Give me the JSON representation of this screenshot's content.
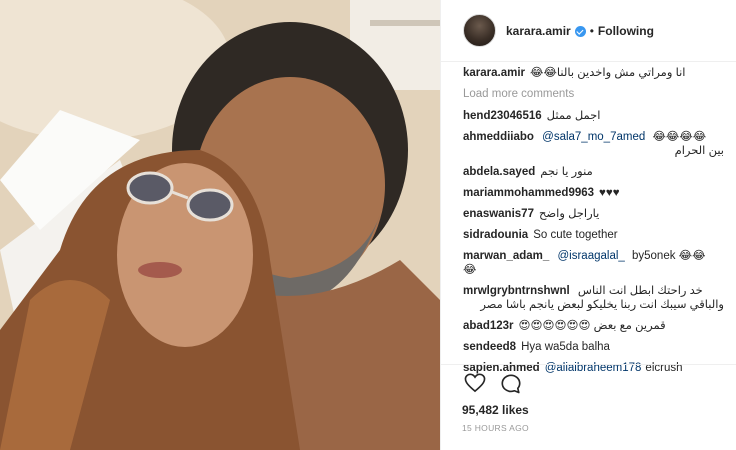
{
  "header": {
    "username": "karara.amir",
    "following_label": "Following",
    "dot": "•"
  },
  "caption": {
    "username": "karara.amir",
    "text": "انا ومراتي مش واخدين بالنا😂😂"
  },
  "load_more_label": "Load more comments",
  "comments": [
    {
      "username": "hend23046516",
      "text": "اجمل ممثل"
    },
    {
      "username": "ahmeddiiabo",
      "mention": "@sala7_mo_7amed",
      "text": "😂😂😂😂",
      "text2": "بين الحرام"
    },
    {
      "username": "abdela.sayed",
      "text": "منور يا نجم"
    },
    {
      "username": "mariammohammed9963",
      "text": "♥♥♥"
    },
    {
      "username": "enaswanis77",
      "text": "ياراجل واضح"
    },
    {
      "username": "sidradounia",
      "text": "So cute together"
    },
    {
      "username": "marwan_adam_",
      "mention": "@israagalal_",
      "text": "by5onek 😂😂",
      "text2": "😂"
    },
    {
      "username": "mrwlgrybntrnshwnl",
      "text": "خد راحتك ابطل انت الناس",
      "text2": "والباقي سيبك انت ربنا يخليكو لبعض يانجم باشا مصر"
    },
    {
      "username": "abad123r",
      "text": "قمرين مع بعض 😍😍😍😍😍😍"
    },
    {
      "username": "sendeed8",
      "text": "Hya wa5da balha"
    },
    {
      "username": "sapien.ahmed",
      "mention": "@aliaibraheem178",
      "text": "elcrush"
    }
  ],
  "actions": {
    "like_icon": "heart-outline-icon",
    "comment_icon": "speech-bubble-icon",
    "likes_count": "95,482 likes",
    "timestamp": "15 HOURS AGO"
  },
  "colors": {
    "verified": "#3897f0",
    "mention": "#003569",
    "muted": "#999999",
    "border": "#efefef"
  }
}
